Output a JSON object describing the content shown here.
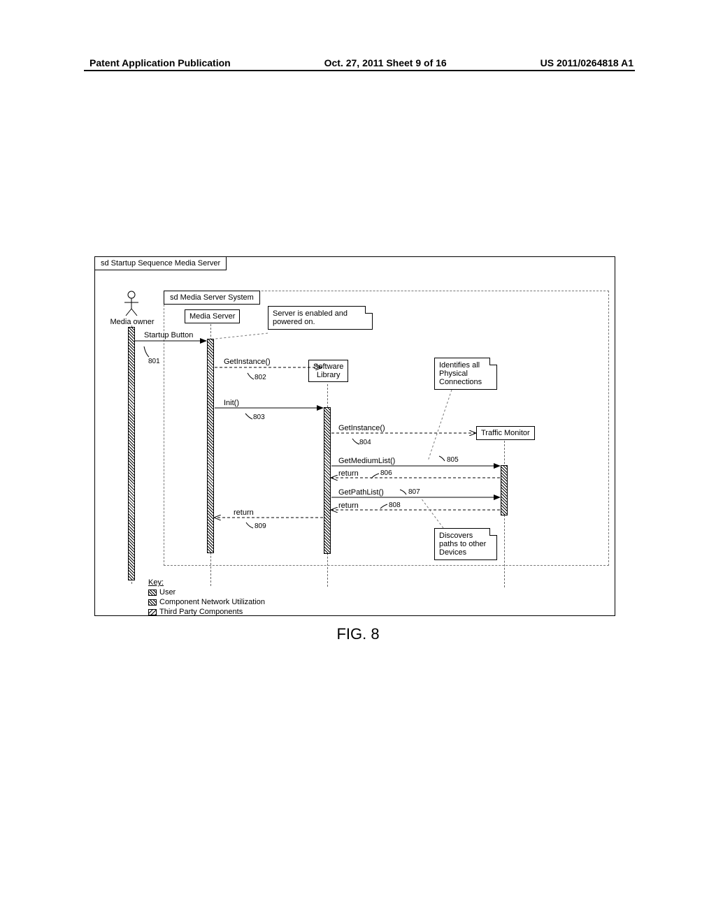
{
  "header": {
    "left": "Patent Application Publication",
    "center": "Oct. 27, 2011  Sheet 9 of 16",
    "right": "US 2011/0264818 A1"
  },
  "caption": "FIG. 8",
  "frames": {
    "outer_tab": "sd Startup Sequence Media Server",
    "inner_tab": "sd Media Server System"
  },
  "actors": {
    "media_owner": "Media owner",
    "media_server": "Media Server",
    "software_library": "Software\nLibrary",
    "traffic_monitor": "Traffic Monitor"
  },
  "notes": {
    "server_enabled": "Server is enabled and powered on.",
    "identifies_conn": "Identifies all Physical Connections",
    "discovers_paths": "Discovers paths to other Devices"
  },
  "messages": {
    "startup_button": "Startup Button",
    "get_instance_1": "GetInstance()",
    "init": "Init()",
    "get_instance_2": "GetInstance()",
    "get_medium_list": "GetMediumList()",
    "return_806": "return",
    "get_path_list": "GetPathList()",
    "return_808": "return",
    "return_809": "return"
  },
  "refs": {
    "801": "801",
    "802": "802",
    "803": "803",
    "804": "804",
    "805": "805",
    "806": "806",
    "807": "807",
    "808": "808",
    "809": "809"
  },
  "key": {
    "title": "Key:",
    "user": "User",
    "cnu": "Component Network Utilization",
    "third": "Third Party Components"
  }
}
